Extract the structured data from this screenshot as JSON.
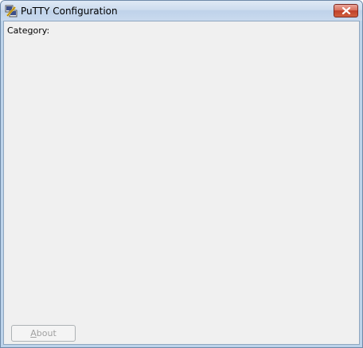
{
  "window": {
    "title": "PuTTY Configuration",
    "icon": "putty-app-icon",
    "close_icon": "close-icon",
    "close_color": "#c0402a"
  },
  "category": {
    "label_pre": "Cate",
    "label_mnemonic": "g",
    "label_post": "ory:"
  },
  "about_button": {
    "label_mnemonic": "A",
    "label_post": "bout",
    "enabled": false
  }
}
